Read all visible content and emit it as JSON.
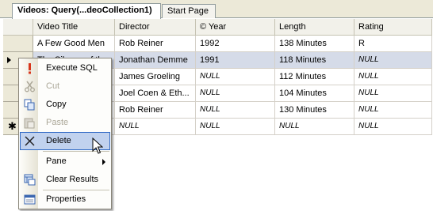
{
  "tabs": [
    {
      "label": "Videos: Query(...deoCollection1)",
      "active": true
    },
    {
      "label": "Start Page",
      "active": false
    }
  ],
  "grid": {
    "columns": [
      "Video Title",
      "Director",
      "© Year",
      "Length",
      "Rating"
    ],
    "rows": [
      {
        "title": "A Few Good Men",
        "director": "Rob Reiner",
        "year": "1992",
        "length": "138 Minutes",
        "rating": "R"
      },
      {
        "title": "The Silence of the",
        "director": "Jonathan Demme",
        "year": "1991",
        "length": "118 Minutes",
        "rating": "NULL"
      },
      {
        "title": "",
        "director": "James Groeling",
        "year": "NULL",
        "length": "112 Minutes",
        "rating": "NULL"
      },
      {
        "title": "",
        "director": "Joel Coen & Eth...",
        "year": "NULL",
        "length": "104 Minutes",
        "rating": "NULL"
      },
      {
        "title": "",
        "director": "Rob Reiner",
        "year": "NULL",
        "length": "130 Minutes",
        "rating": "NULL"
      },
      {
        "title": "",
        "director": "NULL",
        "year": "NULL",
        "length": "NULL",
        "rating": "NULL"
      }
    ]
  },
  "context_menu": {
    "items": [
      {
        "label": "Execute SQL",
        "icon": "execute-sql-icon",
        "enabled": true
      },
      {
        "label": "Cut",
        "icon": "scissors-icon",
        "enabled": false
      },
      {
        "label": "Copy",
        "icon": "copy-icon",
        "enabled": true
      },
      {
        "label": "Paste",
        "icon": "paste-icon",
        "enabled": false
      },
      {
        "label": "Delete",
        "icon": "delete-x-icon",
        "enabled": true,
        "hovered": true
      },
      {
        "label": "Pane",
        "icon": "",
        "enabled": true,
        "submenu": true
      },
      {
        "label": "Clear Results",
        "icon": "clear-results-icon",
        "enabled": true
      },
      {
        "label": "Properties",
        "icon": "properties-icon",
        "enabled": true
      }
    ]
  },
  "colors": {
    "selected_row": "#d5dbe8",
    "menu_hover": "#c1d2ee",
    "menu_hover_border": "#316ac5",
    "execute_icon": "#d8361c"
  }
}
